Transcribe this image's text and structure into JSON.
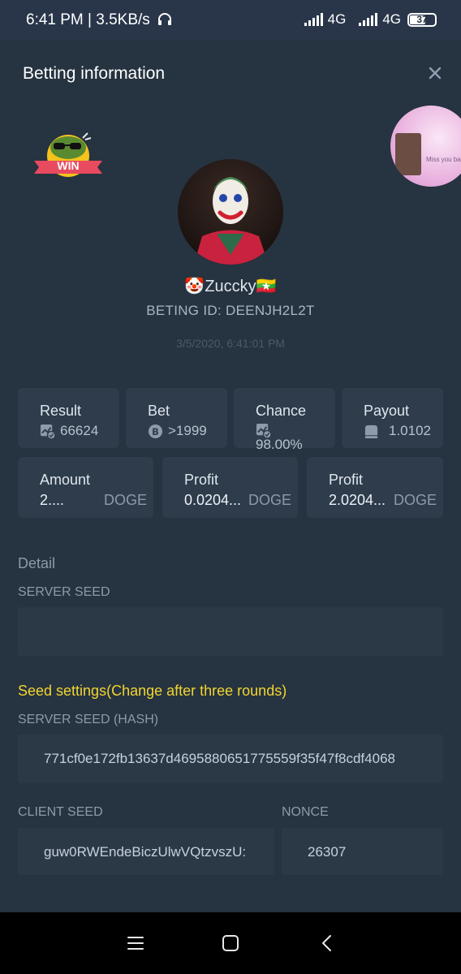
{
  "status_bar": {
    "time": "6:41 PM | 3.5KB/s",
    "network_1": "4G",
    "network_2": "4G",
    "battery": "37"
  },
  "modal": {
    "title": "Betting information",
    "close_label": "×"
  },
  "player": {
    "username": "🤡Zuccky🇲🇲",
    "bet_id": "BETING ID: DEENJH2L2T",
    "datetime": "3/5/2020, 6:41:01 PM",
    "badge_text": "WIN"
  },
  "avatar_caption": "Miss you babe",
  "stats": {
    "result_label": "Result",
    "result_value": "66624",
    "bet_label": "Bet",
    "bet_value": ">1999",
    "chance_label": "Chance",
    "chance_value": "98.00%",
    "payout_label": "Payout",
    "payout_value": "1.0102",
    "amount_label": "Amount",
    "amount_value": "2....",
    "amount_unit": "DOGE",
    "profit1_label": "Profit",
    "profit1_value": "0.0204...",
    "profit1_unit": "DOGE",
    "profit2_label": "Profit",
    "profit2_value": "2.0204...",
    "profit2_unit": "DOGE"
  },
  "detail": {
    "heading": "Detail",
    "server_seed_label": "SERVER SEED",
    "server_seed_value": "",
    "seed_settings_heading": "Seed settings(Change after three rounds)",
    "server_seed_hash_label": "SERVER SEED (HASH)",
    "server_seed_hash_value": "771cf0e172fb13637d4695880651775559f35f47f8cdf4068",
    "client_seed_label": "CLIENT SEED",
    "client_seed_value": "guw0RWEndeBiczUlwVQtzvszU:",
    "nonce_label": "NONCE",
    "nonce_value": "26307"
  },
  "colors": {
    "background": "#263340",
    "card": "#2e3c4b",
    "accent_yellow": "#f2d531",
    "muted_text": "#8d9aa9"
  }
}
